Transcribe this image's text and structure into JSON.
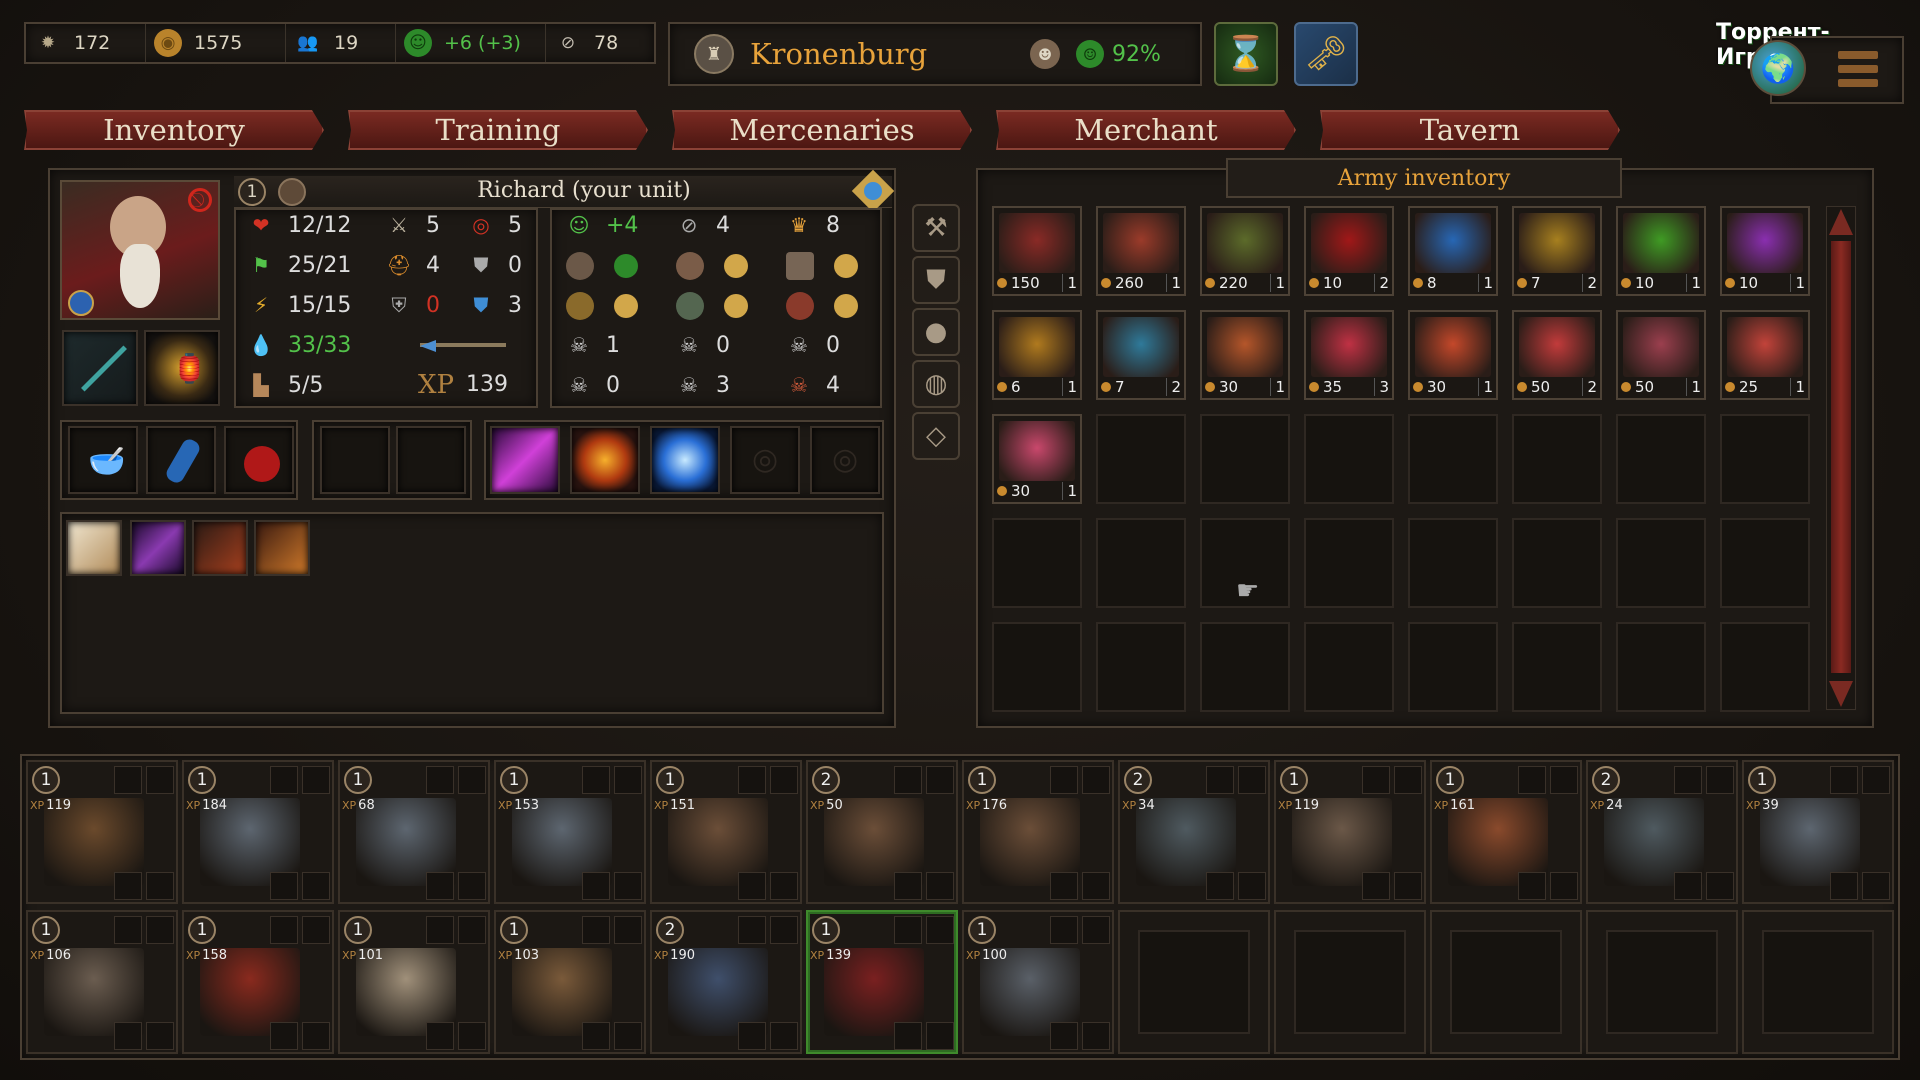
{
  "resources": [
    {
      "icon": "sun-icon",
      "value": "172"
    },
    {
      "icon": "gold-coins-icon",
      "value": "1575"
    },
    {
      "icon": "people-icon",
      "value": "19"
    },
    {
      "icon": "morale-mask-icon",
      "value": "+6 (+3)"
    },
    {
      "icon": "stealth-eye-icon",
      "value": "78"
    }
  ],
  "location": {
    "name": "Kronenburg",
    "morale": "92%"
  },
  "watermark": "Торрент-Игруха.Орг",
  "tabs": [
    "Inventory",
    "Training",
    "Mercenaries",
    "Merchant",
    "Tavern"
  ],
  "hero": {
    "name": "Richard (your unit)",
    "level": "1",
    "stats_left": [
      {
        "icon": "heart-icon",
        "value": "12/12"
      },
      {
        "icon": "flag-icon",
        "value": "25/21"
      },
      {
        "icon": "lightning-icon",
        "value": "15/15"
      },
      {
        "icon": "mana-drop-icon",
        "value": "33/33"
      },
      {
        "icon": "boot-icon",
        "value": "5/5"
      }
    ],
    "stats_mid": [
      {
        "icon": "sword-icon",
        "value": "5"
      },
      {
        "icon": "helmet-icon",
        "value": "4"
      },
      {
        "icon": "shield-icon",
        "value": "0"
      },
      {
        "icon": "arrow-icon",
        "value": ""
      }
    ],
    "stats_mid2": [
      {
        "icon": "target-icon",
        "value": "5"
      },
      {
        "icon": "armor-icon",
        "value": "0"
      },
      {
        "icon": "magic-armor-icon",
        "value": "3"
      }
    ],
    "xp_label": "XP",
    "xp": "139",
    "relations": [
      {
        "icon": "mask-icon",
        "value": "+4"
      },
      {
        "icon": "eye-slash-icon",
        "value": "4"
      },
      {
        "icon": "crown-icon",
        "value": "8"
      },
      {
        "icon": "skull-icon",
        "value": "1"
      },
      {
        "icon": "orc-skull-icon",
        "value": "0"
      },
      {
        "icon": "demon-skull-icon",
        "value": "0"
      },
      {
        "icon": "beast-skull-icon",
        "value": "0"
      },
      {
        "icon": "undead-skull-icon",
        "value": "3"
      },
      {
        "icon": "fiend-skull-icon",
        "value": "4"
      }
    ]
  },
  "army_inventory": {
    "title": "Army inventory",
    "items": [
      {
        "name": "spear",
        "price": "150",
        "qty": "1",
        "color": "#8a2a26"
      },
      {
        "name": "amulet",
        "price": "260",
        "qty": "1",
        "color": "#9b3b2a"
      },
      {
        "name": "skull-trinket",
        "price": "220",
        "qty": "1",
        "color": "#5c6b2a"
      },
      {
        "name": "red-potion",
        "price": "10",
        "qty": "2",
        "color": "#a11818"
      },
      {
        "name": "blue-potion",
        "price": "8",
        "qty": "1",
        "color": "#2767b5"
      },
      {
        "name": "gold-potion",
        "price": "7",
        "qty": "2",
        "color": "#a7801f"
      },
      {
        "name": "green-potion",
        "price": "10",
        "qty": "1",
        "color": "#3f9b24"
      },
      {
        "name": "purple-potion",
        "price": "10",
        "qty": "1",
        "color": "#8a2fb0"
      },
      {
        "name": "honey-pot",
        "price": "6",
        "qty": "1",
        "color": "#b07a1e"
      },
      {
        "name": "bowl",
        "price": "7",
        "qty": "2",
        "color": "#2f7a9a"
      },
      {
        "name": "scroll",
        "price": "30",
        "qty": "1",
        "color": "#b5562a"
      },
      {
        "name": "scroll-skull",
        "price": "35",
        "qty": "3",
        "color": "#c03144"
      },
      {
        "name": "scroll-fire",
        "price": "30",
        "qty": "1",
        "color": "#c4482a"
      },
      {
        "name": "scroll-beast",
        "price": "50",
        "qty": "2",
        "color": "#c23b3b"
      },
      {
        "name": "scroll-helm",
        "price": "50",
        "qty": "1",
        "color": "#9b3f4e"
      },
      {
        "name": "scroll-claw",
        "price": "25",
        "qty": "1",
        "color": "#c2433a"
      },
      {
        "name": "scroll-pink",
        "price": "30",
        "qty": "1",
        "color": "#c9486c"
      }
    ]
  },
  "units": [
    {
      "lvl": "1",
      "xp": "119"
    },
    {
      "lvl": "1",
      "xp": "184"
    },
    {
      "lvl": "1",
      "xp": "68"
    },
    {
      "lvl": "1",
      "xp": "153"
    },
    {
      "lvl": "1",
      "xp": "151"
    },
    {
      "lvl": "2",
      "xp": "50"
    },
    {
      "lvl": "1",
      "xp": "176"
    },
    {
      "lvl": "2",
      "xp": "34"
    },
    {
      "lvl": "1",
      "xp": "119"
    },
    {
      "lvl": "1",
      "xp": "161"
    },
    {
      "lvl": "2",
      "xp": "24"
    },
    {
      "lvl": "1",
      "xp": "39"
    },
    {
      "lvl": "1",
      "xp": "106"
    },
    {
      "lvl": "1",
      "xp": "158"
    },
    {
      "lvl": "1",
      "xp": "101"
    },
    {
      "lvl": "1",
      "xp": "103"
    },
    {
      "lvl": "2",
      "xp": "190"
    },
    {
      "lvl": "1",
      "xp": "139"
    },
    {
      "lvl": "1",
      "xp": "100"
    }
  ],
  "unit_xp_label": "XP"
}
